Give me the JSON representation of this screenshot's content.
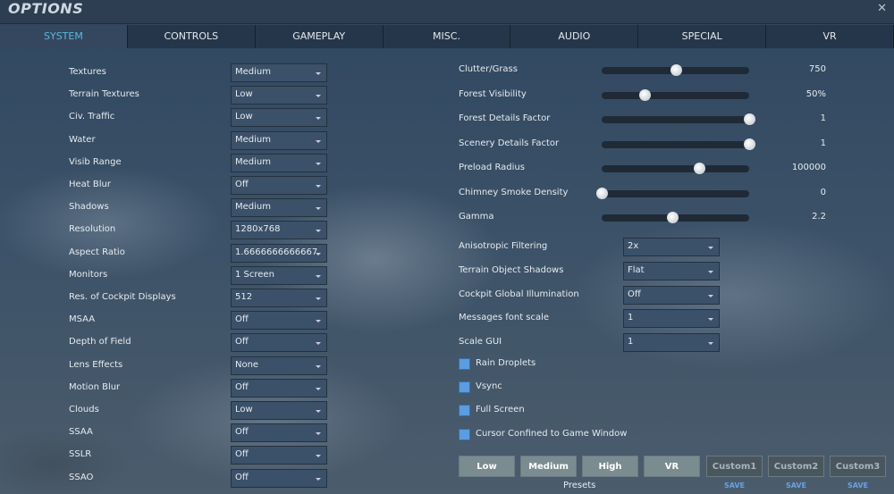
{
  "window": {
    "title": "OPTIONS",
    "close": "✕"
  },
  "tabs": [
    "SYSTEM",
    "CONTROLS",
    "GAMEPLAY",
    "MISC.",
    "AUDIO",
    "SPECIAL",
    "VR"
  ],
  "active_tab": "SYSTEM",
  "left_settings": [
    {
      "label": "Textures",
      "value": "Medium"
    },
    {
      "label": "Terrain Textures",
      "value": "Low"
    },
    {
      "label": "Civ. Traffic",
      "value": "Low"
    },
    {
      "label": "Water",
      "value": "Medium"
    },
    {
      "label": "Visib Range",
      "value": "Medium"
    },
    {
      "label": "Heat Blur",
      "value": "Off"
    },
    {
      "label": "Shadows",
      "value": "Medium"
    },
    {
      "label": "Resolution",
      "value": "1280x768"
    },
    {
      "label": "Aspect Ratio",
      "value": "1.6666666666667"
    },
    {
      "label": "Monitors",
      "value": "1 Screen"
    },
    {
      "label": "Res. of Cockpit Displays",
      "value": "512"
    },
    {
      "label": "MSAA",
      "value": "Off"
    },
    {
      "label": "Depth of Field",
      "value": "Off"
    },
    {
      "label": "Lens Effects",
      "value": "None"
    },
    {
      "label": "Motion Blur",
      "value": "Off"
    },
    {
      "label": "Clouds",
      "value": "Low"
    },
    {
      "label": "SSAA",
      "value": "Off"
    },
    {
      "label": "SSLR",
      "value": "Off"
    },
    {
      "label": "SSAO",
      "value": "Off"
    }
  ],
  "sliders": [
    {
      "label": "Clutter/Grass",
      "value": "750",
      "fraction": 0.5
    },
    {
      "label": "Forest Visibility",
      "value": "50%",
      "fraction": 0.29
    },
    {
      "label": "Forest Details Factor",
      "value": "1",
      "fraction": 1.0
    },
    {
      "label": "Scenery Details Factor",
      "value": "1",
      "fraction": 1.0
    },
    {
      "label": "Preload Radius",
      "value": "100000",
      "fraction": 0.66
    },
    {
      "label": "Chimney Smoke Density",
      "value": "0",
      "fraction": 0.0
    },
    {
      "label": "Gamma",
      "value": "2.2",
      "fraction": 0.48
    }
  ],
  "right_settings": [
    {
      "label": "Anisotropic Filtering",
      "value": "2x"
    },
    {
      "label": "Terrain Object Shadows",
      "value": "Flat"
    },
    {
      "label": "Cockpit Global Illumination",
      "value": "Off"
    },
    {
      "label": "Messages font scale",
      "value": "1"
    },
    {
      "label": "Scale GUI",
      "value": "1"
    }
  ],
  "checkboxes": [
    {
      "label": "Rain Droplets",
      "checked": false
    },
    {
      "label": "Vsync",
      "checked": false
    },
    {
      "label": "Full Screen",
      "checked": false
    },
    {
      "label": "Cursor Confined to Game Window",
      "checked": false
    }
  ],
  "presets": {
    "label": "Presets",
    "buttons": [
      "Low",
      "Medium",
      "High",
      "VR"
    ],
    "custom": [
      "Custom1",
      "Custom2",
      "Custom3"
    ],
    "save_label": "SAVE"
  }
}
